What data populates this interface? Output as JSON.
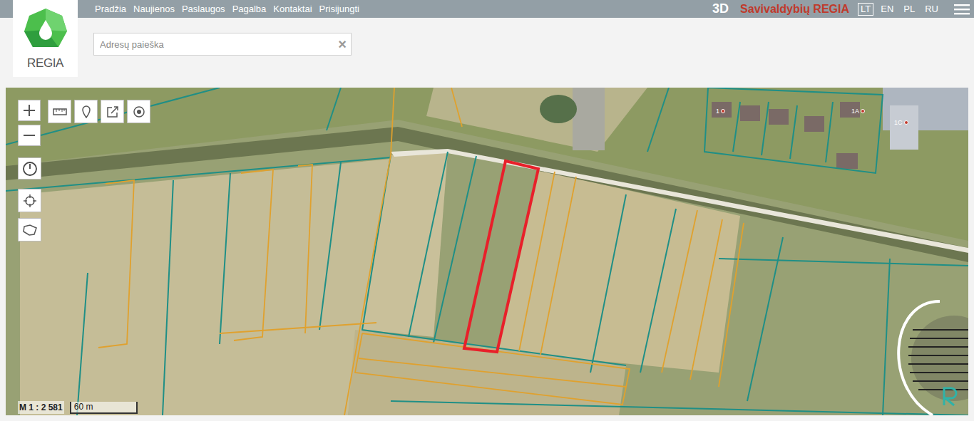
{
  "nav": [
    {
      "label": "Pradžia"
    },
    {
      "label": "Naujienos"
    },
    {
      "label": "Paslaugos"
    },
    {
      "label": "Pagalba"
    },
    {
      "label": "Kontaktai"
    },
    {
      "label": "Prisijungti"
    }
  ],
  "header": {
    "three_d": "3D",
    "title": "Savivaldybių REGIA"
  },
  "languages": [
    {
      "label": "LT",
      "selected": true
    },
    {
      "label": "EN",
      "selected": false
    },
    {
      "label": "PL",
      "selected": false
    },
    {
      "label": "RU",
      "selected": false
    }
  ],
  "logo": {
    "text": "REGIA"
  },
  "search": {
    "placeholder": "Adresų paieška",
    "clear": "×"
  },
  "map": {
    "scale": "M 1 : 2 581",
    "scale_bar": "60 m",
    "labels": [
      {
        "text": "1"
      },
      {
        "text": "1A"
      },
      {
        "text": "1C"
      }
    ]
  }
}
